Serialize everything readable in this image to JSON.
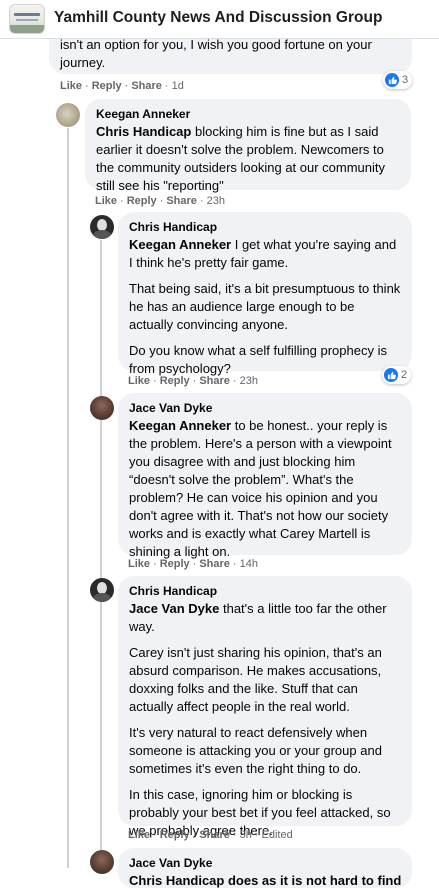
{
  "header": {
    "group_name": "Yamhill County News And Discussion Group"
  },
  "top_comment": {
    "text_line1": "isn't an option for you, I wish you good fortune on your",
    "text_line2": "journey.",
    "like": "Like",
    "reply": "Reply",
    "share": "Share",
    "time": "1d",
    "reaction_count": "3"
  },
  "comments": [
    {
      "author": "Keegan Anneker",
      "mention": "Chris Handicap",
      "paragraphs": [
        " blocking him is fine but as I said earlier it doesn't solve the problem. Newcomers to the community outsiders looking at our community still see his \"reporting\""
      ],
      "like": "Like",
      "reply": "Reply",
      "share": "Share",
      "time": "23h"
    },
    {
      "author": "Chris Handicap",
      "mention": "Keegan Anneker",
      "paragraphs": [
        " I get what you're saying and I think he's pretty fair game.",
        "That being said, it's a bit presumptuous to think he has an audience large enough to be actually convincing anyone.",
        "Do you know what a self fulfilling prophecy is from psychology?"
      ],
      "like": "Like",
      "reply": "Reply",
      "share": "Share",
      "time": "23h",
      "reaction_count": "2"
    },
    {
      "author": "Jace Van Dyke",
      "mention": "Keegan Anneker",
      "paragraphs": [
        " to be honest.. your reply is the problem. Here's a person with a viewpoint you disagree with and just blocking him “doesn't solve the problem”. What's the problem? He can voice his opinion and you don't agree with it. That's not how our society works and is exactly what Carey Martell is shining a light on."
      ],
      "like": "Like",
      "reply": "Reply",
      "share": "Share",
      "time": "14h"
    },
    {
      "author": "Chris Handicap",
      "mention": "Jace Van Dyke",
      "paragraphs": [
        " that's a little too far the other way.",
        "Carey isn't just sharing his opinion, that's an absurd comparison. He makes accusations, doxxing folks and the like. Stuff that can actually affect people in the real world.",
        "It's very natural to react defensively when someone is attacking you or your group and sometimes it's even the right thing to do.",
        "In this case, ignoring him or blocking is probably your best bet if you feel attacked, so we probably agree there."
      ],
      "like": "Like",
      "reply": "Reply",
      "share": "Share",
      "time": "3h",
      "edited": "Edited"
    },
    {
      "author": "Jace Van Dyke",
      "partial_text": "Chris Handicap does as it is not hard to find"
    }
  ]
}
